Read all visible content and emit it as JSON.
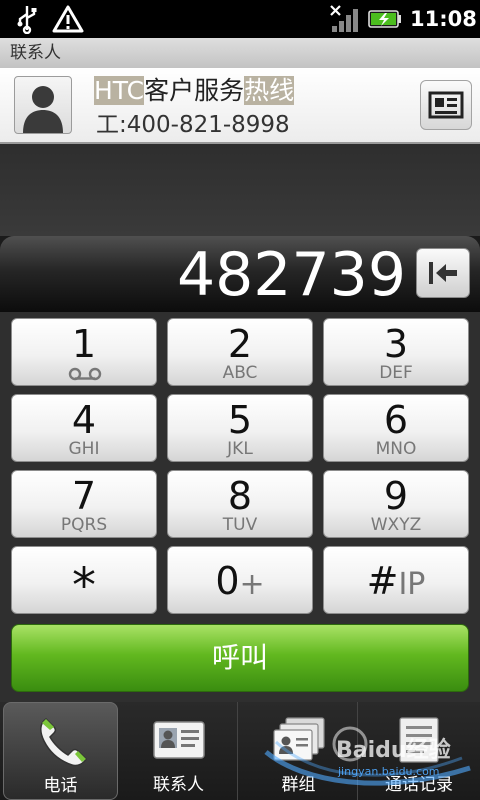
{
  "status_bar": {
    "time": "11:08",
    "icons": [
      "usb-icon",
      "warning-icon",
      "signal-icon",
      "battery-charging-icon"
    ]
  },
  "contacts": {
    "header": "联系人",
    "match": {
      "name_parts": [
        {
          "text": "HTC",
          "highlight": true
        },
        {
          "text": "客户服务",
          "highlight": false
        },
        {
          "text": "热线",
          "highlight": true
        }
      ],
      "number": "工:400-821-8998"
    }
  },
  "dialer": {
    "number": "482739"
  },
  "keypad": [
    {
      "digit": "1",
      "letters": "",
      "icon": "voicemail-icon"
    },
    {
      "digit": "2",
      "letters": "ABC"
    },
    {
      "digit": "3",
      "letters": "DEF"
    },
    {
      "digit": "4",
      "letters": "GHI"
    },
    {
      "digit": "5",
      "letters": "JKL"
    },
    {
      "digit": "6",
      "letters": "MNO"
    },
    {
      "digit": "7",
      "letters": "PQRS"
    },
    {
      "digit": "8",
      "letters": "TUV"
    },
    {
      "digit": "9",
      "letters": "WXYZ"
    },
    {
      "digit": "*",
      "suffix": ""
    },
    {
      "digit": "0",
      "suffix": "+"
    },
    {
      "digit": "#",
      "suffix": "IP"
    }
  ],
  "call_button": "呼叫",
  "tabs": [
    {
      "label": "电话",
      "icon": "phone-icon",
      "active": true
    },
    {
      "label": "联系人",
      "icon": "contact-card-icon",
      "active": false
    },
    {
      "label": "群组",
      "icon": "group-icon",
      "active": false
    },
    {
      "label": "通话记录",
      "icon": "call-log-icon",
      "active": false
    }
  ],
  "watermark": {
    "brand": "Baidu经验",
    "url": "jingyan.baidu.com"
  },
  "colors": {
    "call_green": "#62b81f",
    "highlight": "#b9b2a1"
  }
}
